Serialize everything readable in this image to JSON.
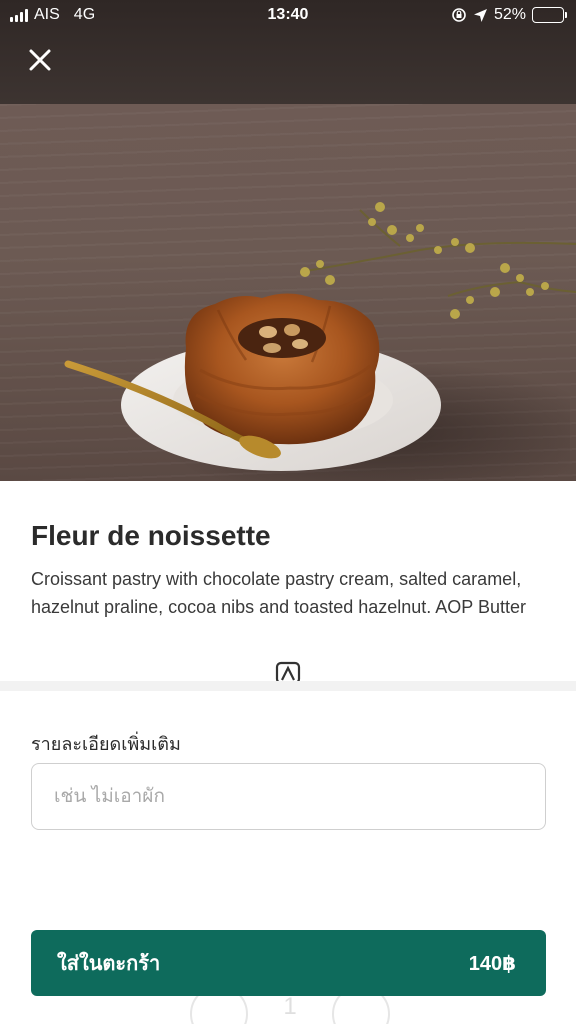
{
  "status_bar": {
    "carrier": "AIS",
    "network": "4G",
    "time": "13:40",
    "battery_percent": "52%",
    "battery_level": 0.52
  },
  "header": {
    "close_icon": "close-icon"
  },
  "product": {
    "name": "Fleur de noissette",
    "description": "Croissant pastry with chocolate pastry cream, salted caramel, hazelnut praline, cocoa nibs and toasted hazelnut. AOP Butter"
  },
  "notes": {
    "label": "รายละเอียดเพิ่มเติม",
    "placeholder": "เช่น ไม่เอาผัก",
    "value": ""
  },
  "quantity": {
    "minus_label": "−",
    "value": "1",
    "plus_label": "+"
  },
  "cart_button": {
    "label": "ใส่ในตะกร้า",
    "price": "140฿"
  },
  "colors": {
    "accent": "#0e6b5c",
    "text": "#2b2b2b",
    "divider": "#f2f2f2"
  }
}
